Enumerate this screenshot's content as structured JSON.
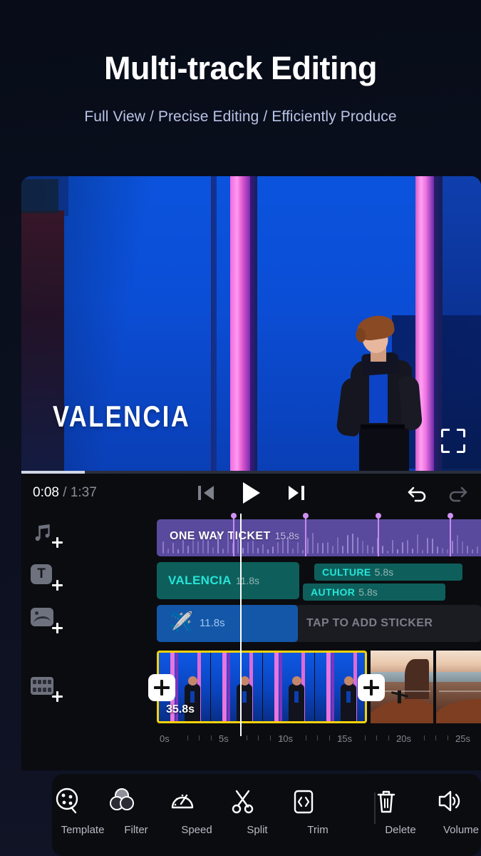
{
  "header": {
    "title": "Multi-track Editing",
    "subtitle": "Full View / Precise Editing / Efficiently Produce"
  },
  "preview": {
    "overlay_text": "VALENCIA",
    "fullscreen_icon": "fullscreen-icon",
    "progress_percent": 13.8
  },
  "controls": {
    "current_time": "0:08",
    "separator": "/",
    "total_time": "1:37",
    "prev_icon": "skip-previous-icon",
    "play_icon": "play-icon",
    "next_icon": "skip-next-icon",
    "undo_icon": "undo-icon",
    "redo_icon": "redo-icon"
  },
  "timeline": {
    "tracks": [
      {
        "type": "audio",
        "add_icon": "add-music-icon",
        "clip_label": "ONE WAY TICKET",
        "clip_duration": "15.8s"
      },
      {
        "type": "text",
        "add_icon": "add-text-icon",
        "clips": [
          {
            "label": "VALENCIA",
            "duration": "11.8s"
          },
          {
            "label": "CULTURE",
            "duration": "5.8s"
          },
          {
            "label": "AUTHOR",
            "duration": "5.8s"
          }
        ]
      },
      {
        "type": "sticker",
        "add_icon": "add-sticker-icon",
        "emoji": "✈️",
        "clip_duration": "11.8s",
        "placeholder": "TAP TO ADD STICKER"
      },
      {
        "type": "video",
        "add_icon": "add-video-icon",
        "clip_duration": "35.8s",
        "add_left_label": "+",
        "add_right_label": "+"
      }
    ],
    "ruler_labels": [
      "0s",
      "5s",
      "10s",
      "15s",
      "20s",
      "25s"
    ],
    "colors": {
      "audio_clip": "#5a4a9e",
      "beat_marker": "#cf90f5",
      "text_clip": "#0e5f5c",
      "text_accent": "#25e5d8",
      "sticker_clip": "#1457a8",
      "selection_border": "#f5d20a",
      "playhead": "#ffffff"
    }
  },
  "toolbar": {
    "items": [
      {
        "label": "Template",
        "icon": "film-reel-icon"
      },
      {
        "label": "Filter",
        "icon": "filter-circles-icon"
      },
      {
        "label": "Speed",
        "icon": "speedometer-icon"
      },
      {
        "label": "Split",
        "icon": "scissors-icon"
      },
      {
        "label": "Trim",
        "icon": "trim-brackets-icon"
      },
      {
        "label": "Delete",
        "icon": "trash-icon"
      },
      {
        "label": "Volume",
        "icon": "speaker-icon"
      }
    ]
  }
}
